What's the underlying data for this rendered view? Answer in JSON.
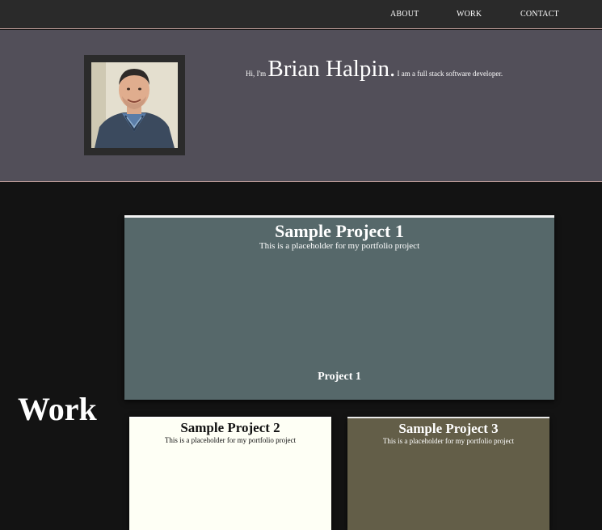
{
  "nav": {
    "about": "About",
    "work": "Work",
    "contact": "Contact"
  },
  "hero": {
    "greeting": "Hi, I'm",
    "name": "Brian Halpin.",
    "tagline": "I am a full stack software developer.",
    "photo_icon": "profile-photo"
  },
  "work": {
    "heading": "Work",
    "projects": [
      {
        "title": "Sample Project 1",
        "description": "This is a placeholder for my portfolio project",
        "footer": "Project 1"
      },
      {
        "title": "Sample Project 2",
        "description": "This is a placeholder for my portfolio project"
      },
      {
        "title": "Sample Project 3",
        "description": "This is a placeholder for my portfolio project"
      }
    ]
  },
  "colors": {
    "navbar": "#2a2a2a",
    "hero": "#524f59",
    "accent_border": "#c9a5a0",
    "background": "#131313",
    "card1": "#56686a",
    "card2": "#fefff5",
    "card3": "#635e48"
  }
}
